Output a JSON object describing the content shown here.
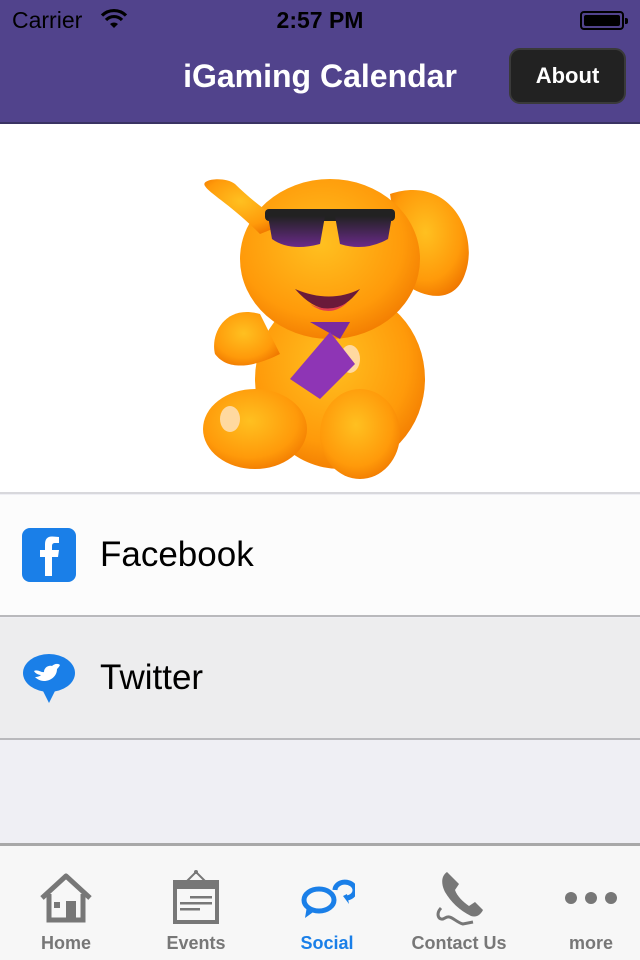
{
  "status_bar": {
    "carrier": "Carrier",
    "time": "2:57 PM",
    "wifi_icon": "wifi-icon",
    "battery_icon": "battery-full-icon"
  },
  "header": {
    "title": "iGaming Calendar",
    "about_label": "About",
    "background_color": "#51438c"
  },
  "hero": {
    "image": "orange-elephant-mascot-with-sunglasses-and-purple-tie"
  },
  "social_links": [
    {
      "label": "Facebook",
      "icon": "facebook-icon",
      "icon_color": "#1a7fe8"
    },
    {
      "label": "Twitter",
      "icon": "twitter-bird-bubble-icon",
      "icon_color": "#1a7fe8"
    }
  ],
  "tabbar": {
    "active_color": "#1a7fe8",
    "inactive_color": "#777777",
    "tabs": [
      {
        "label": "Home",
        "icon": "home-icon",
        "active": false
      },
      {
        "label": "Events",
        "icon": "calendar-icon",
        "active": false
      },
      {
        "label": "Social",
        "icon": "chat-bubbles-icon",
        "active": true
      },
      {
        "label": "Contact Us",
        "icon": "phone-icon",
        "active": false
      },
      {
        "label": "more",
        "icon": "more-dots-icon",
        "active": false
      }
    ]
  }
}
